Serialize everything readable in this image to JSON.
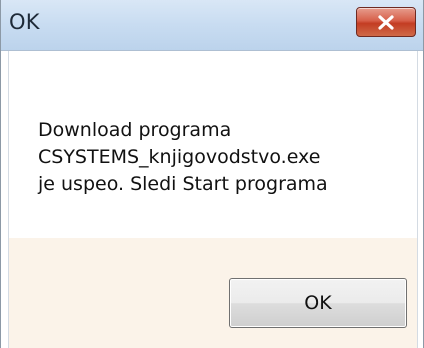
{
  "window": {
    "title": "OK"
  },
  "message": {
    "lines": [
      "Download programa",
      "CSYSTEMS_knjigovodstvo.exe",
      "je uspeo. Sledi Start programa"
    ]
  },
  "buttons": {
    "ok_label": "OK"
  },
  "icons": {
    "close": "close-icon"
  },
  "colors": {
    "titlebar": "#c8dcf1",
    "close_button": "#c9432a",
    "footer_background": "#fbf3e9"
  }
}
